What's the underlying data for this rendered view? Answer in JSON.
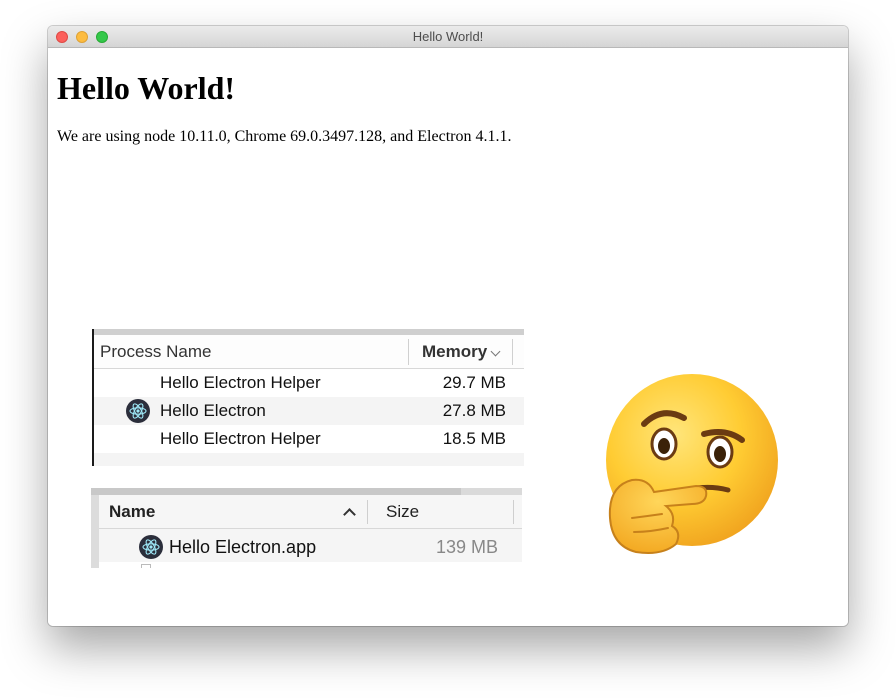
{
  "window": {
    "title": "Hello World!",
    "controls": [
      "close",
      "minimize",
      "zoom"
    ]
  },
  "page": {
    "heading": "Hello World!",
    "versions_text": "We are using node 10.11.0, Chrome 69.0.3497.128, and Electron 4.1.1."
  },
  "activity_monitor": {
    "columns": [
      "Process Name",
      "Memory"
    ],
    "sort_icon": "chevron-down-icon",
    "rows": [
      {
        "name": "Hello Electron Helper",
        "memory": "29.7 MB",
        "icon": null
      },
      {
        "name": "Hello Electron",
        "memory": "27.8 MB",
        "icon": "electron-icon"
      },
      {
        "name": "Hello Electron Helper",
        "memory": "18.5 MB",
        "icon": null
      }
    ]
  },
  "finder": {
    "columns": [
      "Name",
      "Size"
    ],
    "sort_icon": "chevron-up-icon",
    "rows": [
      {
        "name": "Hello Electron.app",
        "size": "139 MB",
        "icon": "electron-icon"
      }
    ]
  },
  "decoration": {
    "emoji": "thinking-face-emoji"
  },
  "colors": {
    "close": "#fc605c",
    "minimize": "#fdbc40",
    "zoom": "#34c84a",
    "electron_icon_bg": "#2b2e3b",
    "electron_icon_fg": "#9feaf9",
    "emoji_face": "#ffcc33"
  }
}
